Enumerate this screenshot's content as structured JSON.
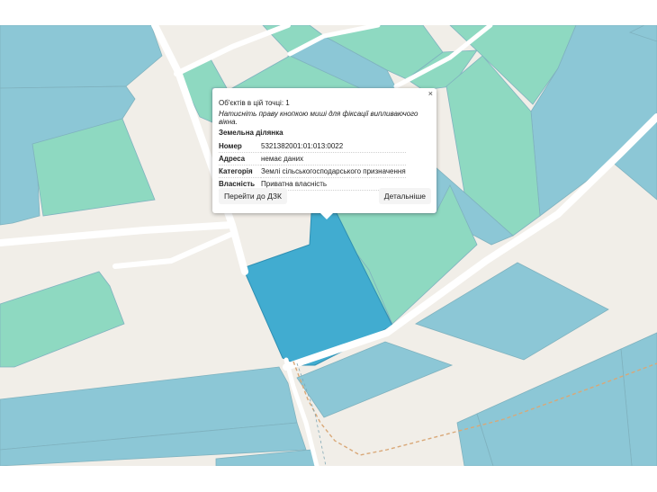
{
  "colors": {
    "background": "#f1eee8",
    "road": "#ffffff",
    "parcel_blue": "#8cc7d6",
    "parcel_green": "#8ed9c1",
    "parcel_selected": "#41acd0",
    "boundary_dash": "#d9a878"
  },
  "popup": {
    "close_symbol": "×",
    "objects_count_text": "Об'єктів в цій точці: 1",
    "hint_text": "Натисніть праву кнопкою миші для фіксації випливаючого вікна.",
    "section_title": "Земельна ділянка",
    "fields": [
      {
        "label": "Номер",
        "value": "5321382001:01:013:0022"
      },
      {
        "label": "Адреса",
        "value": "немає даних"
      },
      {
        "label": "Категорія",
        "value": "Землі сільськогосподарського призначення"
      },
      {
        "label": "Власність",
        "value": "Приватна власність"
      }
    ],
    "button_dzk": "Перейти до ДЗК",
    "button_details": "Детальніше"
  }
}
